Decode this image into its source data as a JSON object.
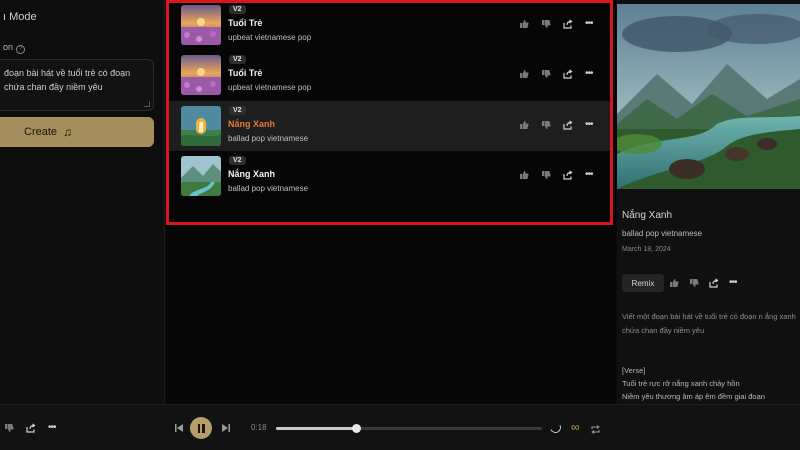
{
  "left": {
    "mode_label": "ı Mode",
    "description_label": "on",
    "description_text": "đoạn bài hát về tuổi trẻ có đoạn\nchứa chan đầy niềm yêu",
    "create_label": "Create"
  },
  "songs": [
    {
      "version": "V2",
      "title": "Tuổi Trẻ",
      "style": "upbeat vietnamese pop",
      "active": false,
      "thumb": "sunset-flowers"
    },
    {
      "version": "V2",
      "title": "Tuổi Trẻ",
      "style": "upbeat vietnamese pop",
      "active": false,
      "thumb": "sunset-flowers"
    },
    {
      "version": "V2",
      "title": "Nắng Xanh",
      "style": "ballad pop vietnamese",
      "active": true,
      "thumb": "glowing-doorway"
    },
    {
      "version": "V2",
      "title": "Nắng Xanh",
      "style": "ballad pop vietnamese",
      "active": false,
      "thumb": "mountain-river"
    }
  ],
  "detail": {
    "title": "Nắng Xanh",
    "style": "ballad pop vietnamese",
    "date": "March 18, 2024",
    "remix_label": "Remix",
    "prompt_text": "Viết một đoạn bài hát về tuổi trẻ có đoạn n ắng xanh chứa chan đầy niềm yêu",
    "lyrics": [
      "[Verse]",
      "Tuổi trẻ rực rỡ nắng xanh chảy hồn",
      "Niềm yêu thương âm áp êm đềm giai đoạn"
    ]
  },
  "player": {
    "time": "0:18",
    "progress": 0.3
  },
  "colors": {
    "accent_gold": "#a58e5d",
    "active_title": "#e07b3c",
    "highlight_border": "#d9161e"
  },
  "icons": [
    "thumbs-up-icon",
    "thumbs-down-icon",
    "share-icon",
    "more-icon",
    "music-note-icon",
    "help-icon",
    "previous-icon",
    "pause-icon",
    "next-icon",
    "loading-icon",
    "infinity-icon",
    "repeat-icon"
  ]
}
